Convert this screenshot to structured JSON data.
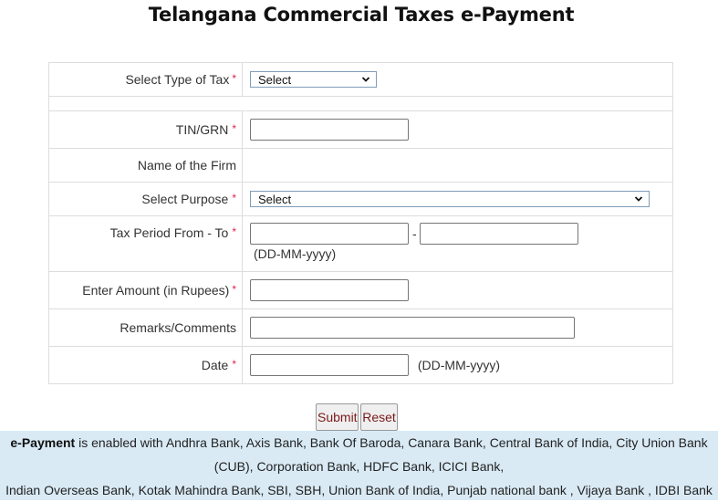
{
  "page": {
    "title": "Telangana Commercial Taxes e-Payment"
  },
  "form": {
    "required_marker": "*",
    "tax_type": {
      "label": "Select Type of Tax",
      "selected": "Select"
    },
    "tin_grn": {
      "label": "TIN/GRN",
      "value": ""
    },
    "firm_name": {
      "label": "Name of the Firm",
      "value": ""
    },
    "purpose": {
      "label": "Select Purpose",
      "selected": "Select"
    },
    "tax_period": {
      "label": "Tax Period From - To",
      "from_value": "",
      "to_value": "",
      "separator": "-",
      "format_hint": "(DD-MM-yyyy)"
    },
    "amount": {
      "label": "Enter Amount (in Rupees)",
      "value": ""
    },
    "remarks": {
      "label": "Remarks/Comments",
      "value": ""
    },
    "date": {
      "label": "Date",
      "value": "",
      "format_hint": "(DD-MM-yyyy)"
    }
  },
  "actions": {
    "submit_label": "Submit",
    "reset_label": "Reset"
  },
  "info_banner": {
    "bold_text": "e-Payment",
    "line1_rest": " is enabled with Andhra Bank, Axis Bank, Bank Of Baroda, Canara Bank, Central Bank of India, City Union Bank",
    "line2": "(CUB), Corporation Bank, HDFC Bank, ICICI Bank,",
    "line3": "Indian Overseas Bank, Kotak Mahindra Bank, SBI, SBH, Union Bank of India, Punjab national bank , Vijaya Bank , IDBI Bank"
  }
}
